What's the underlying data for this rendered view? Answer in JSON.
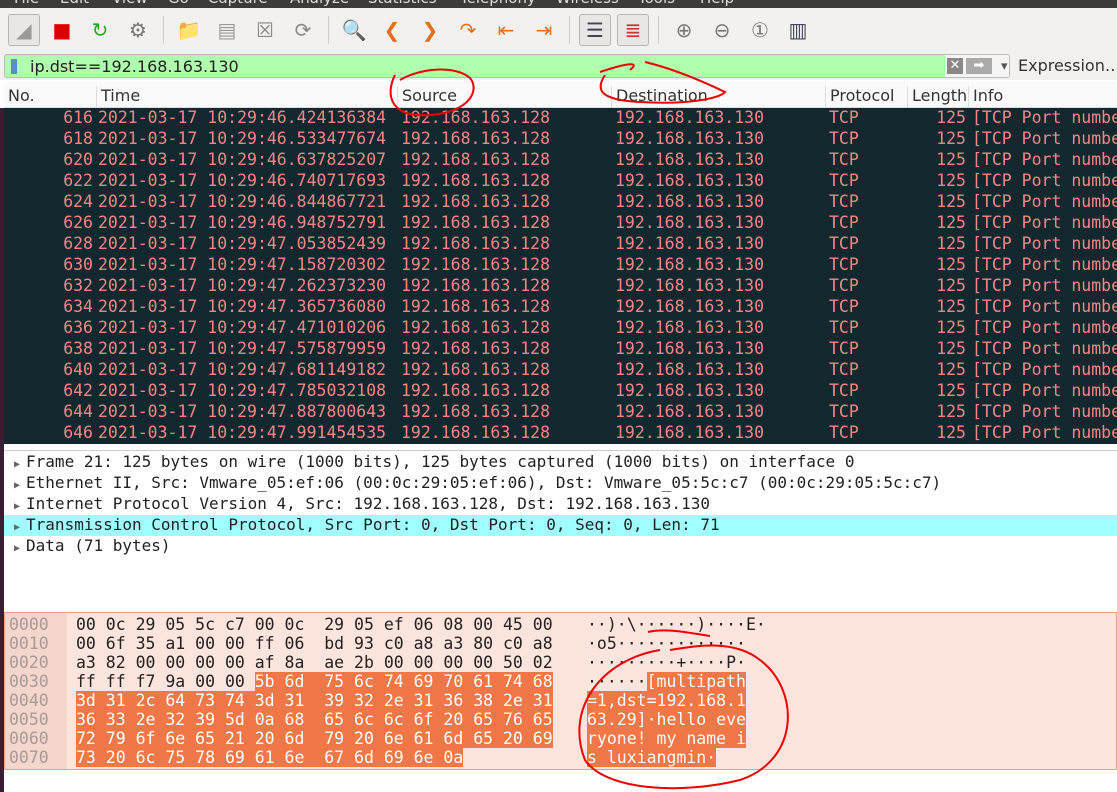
{
  "menu": [
    "File",
    "Edit",
    "View",
    "Go",
    "Capture",
    "Analyze",
    "Statistics",
    "Telephony",
    "Wireless",
    "Tools",
    "Help"
  ],
  "toolbar": [
    {
      "icon": "shark-fin-icon",
      "glyph": "◢",
      "color": "#999"
    },
    {
      "icon": "stop-capture-icon",
      "glyph": "■",
      "color": "#d00"
    },
    {
      "icon": "restart-capture-icon",
      "glyph": "↻",
      "color": "#2a2"
    },
    {
      "icon": "capture-options-gear-icon",
      "glyph": "⚙",
      "color": "#777"
    },
    {
      "icon": "open-file-icon",
      "glyph": "📁",
      "color": "#888"
    },
    {
      "icon": "save-file-icon",
      "glyph": "▤",
      "color": "#999"
    },
    {
      "icon": "close-file-icon",
      "glyph": "☒",
      "color": "#888"
    },
    {
      "icon": "reload-file-icon",
      "glyph": "⟳",
      "color": "#888"
    },
    {
      "icon": "find-packet-icon",
      "glyph": "🔍",
      "color": "#24a"
    },
    {
      "icon": "go-back-icon",
      "glyph": "❮",
      "color": "#e07020"
    },
    {
      "icon": "go-forward-icon",
      "glyph": "❯",
      "color": "#e07020"
    },
    {
      "icon": "go-to-packet-icon",
      "glyph": "↷",
      "color": "#e07020"
    },
    {
      "icon": "first-packet-icon",
      "glyph": "⇤",
      "color": "#e07020"
    },
    {
      "icon": "last-packet-icon",
      "glyph": "⇥",
      "color": "#e07020"
    },
    {
      "icon": "auto-scroll-icon",
      "glyph": "☰",
      "color": "#445"
    },
    {
      "icon": "colorize-icon",
      "glyph": "≣",
      "color": "#c33"
    },
    {
      "icon": "zoom-in-icon",
      "glyph": "⊕",
      "color": "#777"
    },
    {
      "icon": "zoom-out-icon",
      "glyph": "⊖",
      "color": "#777"
    },
    {
      "icon": "normal-size-icon",
      "glyph": "①",
      "color": "#777"
    },
    {
      "icon": "resize-columns-icon",
      "glyph": "▥",
      "color": "#446"
    }
  ],
  "filter": {
    "value": "ip.dst==192.168.163.130",
    "expression_label": "Expression…",
    "clear_glyph": "✕",
    "apply_glyph": "➡",
    "dropdown_glyph": "▾"
  },
  "columns": [
    "No.",
    "Time",
    "Source",
    "Destination",
    "Protocol",
    "Length",
    "Info"
  ],
  "packets": [
    [
      "616",
      "2021-03-17 10:29:46.424136384",
      "192.168.163.128",
      "192.168.163.130",
      "TCP",
      "125",
      "[TCP Port numbe"
    ],
    [
      "618",
      "2021-03-17 10:29:46.533477674",
      "192.168.163.128",
      "192.168.163.130",
      "TCP",
      "125",
      "[TCP Port numbe"
    ],
    [
      "620",
      "2021-03-17 10:29:46.637825207",
      "192.168.163.128",
      "192.168.163.130",
      "TCP",
      "125",
      "[TCP Port numbe"
    ],
    [
      "622",
      "2021-03-17 10:29:46.740717693",
      "192.168.163.128",
      "192.168.163.130",
      "TCP",
      "125",
      "[TCP Port numbe"
    ],
    [
      "624",
      "2021-03-17 10:29:46.844867721",
      "192.168.163.128",
      "192.168.163.130",
      "TCP",
      "125",
      "[TCP Port numbe"
    ],
    [
      "626",
      "2021-03-17 10:29:46.948752791",
      "192.168.163.128",
      "192.168.163.130",
      "TCP",
      "125",
      "[TCP Port numbe"
    ],
    [
      "628",
      "2021-03-17 10:29:47.053852439",
      "192.168.163.128",
      "192.168.163.130",
      "TCP",
      "125",
      "[TCP Port numbe"
    ],
    [
      "630",
      "2021-03-17 10:29:47.158720302",
      "192.168.163.128",
      "192.168.163.130",
      "TCP",
      "125",
      "[TCP Port numbe"
    ],
    [
      "632",
      "2021-03-17 10:29:47.262373230",
      "192.168.163.128",
      "192.168.163.130",
      "TCP",
      "125",
      "[TCP Port numbe"
    ],
    [
      "634",
      "2021-03-17 10:29:47.365736080",
      "192.168.163.128",
      "192.168.163.130",
      "TCP",
      "125",
      "[TCP Port numbe"
    ],
    [
      "636",
      "2021-03-17 10:29:47.471010206",
      "192.168.163.128",
      "192.168.163.130",
      "TCP",
      "125",
      "[TCP Port numbe"
    ],
    [
      "638",
      "2021-03-17 10:29:47.575879959",
      "192.168.163.128",
      "192.168.163.130",
      "TCP",
      "125",
      "[TCP Port numbe"
    ],
    [
      "640",
      "2021-03-17 10:29:47.681149182",
      "192.168.163.128",
      "192.168.163.130",
      "TCP",
      "125",
      "[TCP Port numbe"
    ],
    [
      "642",
      "2021-03-17 10:29:47.785032108",
      "192.168.163.128",
      "192.168.163.130",
      "TCP",
      "125",
      "[TCP Port numbe"
    ],
    [
      "644",
      "2021-03-17 10:29:47.887800643",
      "192.168.163.128",
      "192.168.163.130",
      "TCP",
      "125",
      "[TCP Port numbe"
    ],
    [
      "646",
      "2021-03-17 10:29:47.991454535",
      "192.168.163.128",
      "192.168.163.130",
      "TCP",
      "125",
      "[TCP Port numbe"
    ]
  ],
  "details": [
    {
      "text": "Frame 21: 125 bytes on wire (1000 bits), 125 bytes captured (1000 bits) on interface 0",
      "selected": false
    },
    {
      "text": "Ethernet II, Src: Vmware_05:ef:06 (00:0c:29:05:ef:06), Dst: Vmware_05:5c:c7 (00:0c:29:05:5c:c7)",
      "selected": false
    },
    {
      "text": "Internet Protocol Version 4, Src: 192.168.163.128, Dst: 192.168.163.130",
      "selected": false
    },
    {
      "text": "Transmission Control Protocol, Src Port: 0, Dst Port: 0, Seq: 0, Len: 71",
      "selected": true
    },
    {
      "text": "Data (71 bytes)",
      "selected": false
    }
  ],
  "hex": {
    "highlight_start": 54,
    "highlight_length": 71,
    "rows": [
      {
        "offset": "0000",
        "bytes": [
          "00",
          "0c",
          "29",
          "05",
          "5c",
          "c7",
          "00",
          "0c",
          "29",
          "05",
          "ef",
          "06",
          "08",
          "00",
          "45",
          "00"
        ],
        "ascii": "··)·\\······)····E·"
      },
      {
        "offset": "0010",
        "bytes": [
          "00",
          "6f",
          "35",
          "a1",
          "00",
          "00",
          "ff",
          "06",
          "bd",
          "93",
          "c0",
          "a8",
          "a3",
          "80",
          "c0",
          "a8"
        ],
        "ascii": "·o5·············"
      },
      {
        "offset": "0020",
        "bytes": [
          "a3",
          "82",
          "00",
          "00",
          "00",
          "00",
          "af",
          "8a",
          "ae",
          "2b",
          "00",
          "00",
          "00",
          "00",
          "50",
          "02"
        ],
        "ascii": "·········+····P·"
      },
      {
        "offset": "0030",
        "bytes": [
          "ff",
          "ff",
          "f7",
          "9a",
          "00",
          "00",
          "5b",
          "6d",
          "75",
          "6c",
          "74",
          "69",
          "70",
          "61",
          "74",
          "68"
        ],
        "ascii": "······[multipath"
      },
      {
        "offset": "0040",
        "bytes": [
          "3d",
          "31",
          "2c",
          "64",
          "73",
          "74",
          "3d",
          "31",
          "39",
          "32",
          "2e",
          "31",
          "36",
          "38",
          "2e",
          "31"
        ],
        "ascii": "=1,dst=192.168.1"
      },
      {
        "offset": "0050",
        "bytes": [
          "36",
          "33",
          "2e",
          "32",
          "39",
          "5d",
          "0a",
          "68",
          "65",
          "6c",
          "6c",
          "6f",
          "20",
          "65",
          "76",
          "65"
        ],
        "ascii": "63.29]·hello eve"
      },
      {
        "offset": "0060",
        "bytes": [
          "72",
          "79",
          "6f",
          "6e",
          "65",
          "21",
          "20",
          "6d",
          "79",
          "20",
          "6e",
          "61",
          "6d",
          "65",
          "20",
          "69"
        ],
        "ascii": "ryone! my name i"
      },
      {
        "offset": "0070",
        "bytes": [
          "73",
          "20",
          "6c",
          "75",
          "78",
          "69",
          "61",
          "6e",
          "67",
          "6d",
          "69",
          "6e",
          "0a"
        ],
        "ascii": "s luxiangmin·"
      }
    ]
  },
  "colors": {
    "packet_bg": "#12272e",
    "packet_fg": "#f78787",
    "filter_valid": "#afffaf",
    "selected_detail": "#a0ffff",
    "hex_highlight": "#f07848",
    "annotation": "#e00000"
  }
}
